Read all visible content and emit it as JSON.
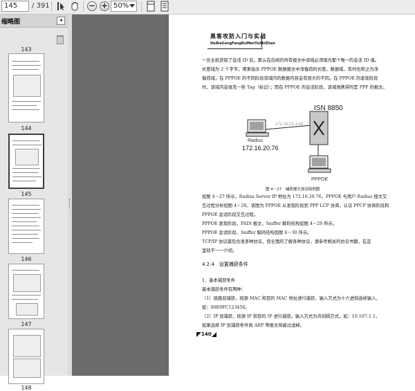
{
  "toolbar": {
    "current_page": "145",
    "total_pages": "/ 391",
    "zoom": "50%",
    "icons": [
      "select-tool-icon",
      "hand-tool-icon",
      "zoom-out-icon",
      "zoom-in-icon",
      "fit-page-icon",
      "fit-width-icon"
    ]
  },
  "sidebar": {
    "title": "缩略图",
    "thumbnails": [
      {
        "label": "143"
      },
      {
        "label": "144"
      },
      {
        "label": "145"
      },
      {
        "label": "146"
      },
      {
        "label": "147"
      },
      {
        "label": "148"
      }
    ]
  },
  "page": {
    "header_cn": "黑客攻防入门与实战",
    "header_pinyin": "HeiKeGongFangRuMenYuShiZhan",
    "paragraph1": [
      "一旦主机获取了会话 ID 后，那么在后续的所有报文中该域必须填为那个唯一的会话 ID 值。",
      "长度域为 2 个字节，用来指示 PPPOE 数据报文中净载荷的长度。数据域，有时也称之为净",
      "载荷域，在 PPPOE 的不同阶段该域内的数据内容会有很大的不同。在 PPPOE 的发现阶段",
      "时，该域内会填充一些 Tag（标记）；而在 PPPOE 的会话阶段，该域则携带的是 PPP 的报文。"
    ],
    "figure": {
      "isn_label": "ISN 8850",
      "ip_top": "172.16.16.1/16",
      "radius_label": "Radius",
      "radius_ip": "172.16.20.76",
      "pppoe_label": "PPPOE"
    },
    "caption": "图 4－27　捕获报文测试用例图",
    "paragraph2": [
      "如图 4－27 所示，Radius Server IP 地址为 172.16.20.76，PPPOE 与用户 Radius 报文交",
      "互过程分析如图 4－28。该图为 PPPOE 从发现阶段到 PPP LCP 协商，认证 PPCP 协商阶段和",
      "PPPOE 会话阶段交互过程。",
      "PPPOE 发现阶段，PADI 报文，Sniffer 解码结构如图 4－29 所示。",
      "PPPOE 会话阶段，Sniffer 解码结构如图 4－30 所示。",
      "TCP/IP 协议簇包含很多种协议，但全面的了解各种协议，请参考相关的协议书籍，在这",
      "里就不一一介绍。"
    ],
    "section_heading": "4.2.4　设置捕获条件",
    "paragraph3": [
      "1．基本捕获条件",
      "基本捕获条件有两种：",
      "（1）链路层捕获，按源 MAC 和目的 MAC 地址进行捕获，输入方式为十六进制连续输入，",
      "如：00E0FC123456。",
      "（2）IP 层捕获，按源 IP 和目的 IP 进行捕获。输入方式为点间隔方式，如：10.107.1.1。",
      "如果选择 IP 层捕获条件则 ARP 等报文将被过滤掉。"
    ],
    "page_number": "140"
  }
}
